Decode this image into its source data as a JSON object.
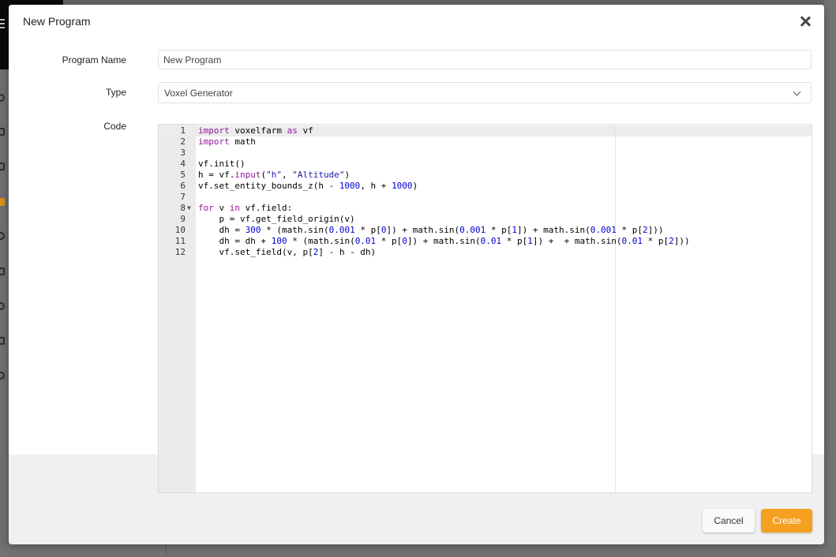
{
  "dialog": {
    "title": "New Program",
    "close_icon": "close-icon"
  },
  "form": {
    "program_name": {
      "label": "Program Name",
      "value": "New Program"
    },
    "type": {
      "label": "Type",
      "selected": "Voxel Generator"
    },
    "code": {
      "label": "Code"
    }
  },
  "editor": {
    "lines": [
      "1",
      "2",
      "3",
      "4",
      "5",
      "6",
      "7",
      "8",
      "9",
      "10",
      "11",
      "12"
    ]
  },
  "buttons": {
    "cancel": "Cancel",
    "create": "Create"
  },
  "colors": {
    "accent": "#f5a021",
    "keyword": "#93159a",
    "number": "#0000cd"
  }
}
